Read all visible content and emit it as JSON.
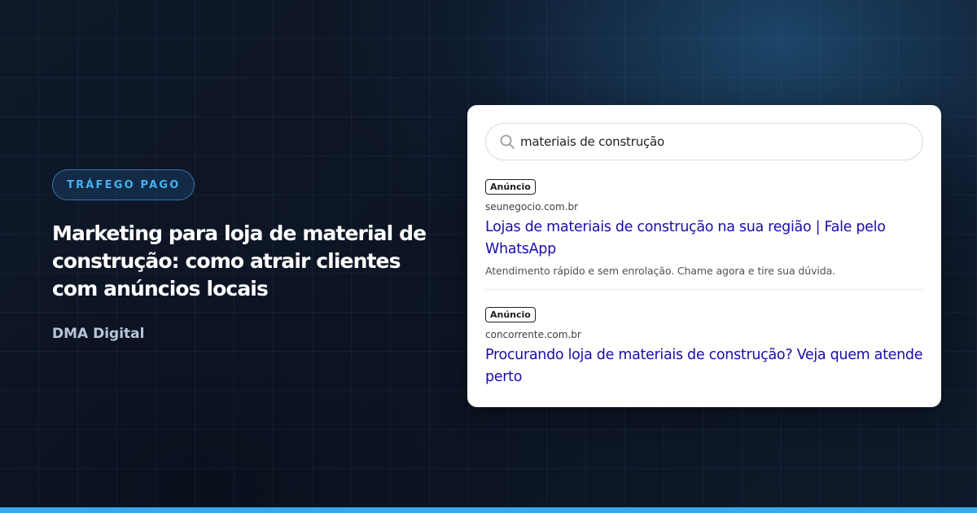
{
  "hero": {
    "category": "TRÁFEGO PAGO",
    "title": "Marketing para loja de material de construção: como atrair clientes com anúncios locais",
    "author": "DMA Digital"
  },
  "search": {
    "query": "materiais de construção",
    "icon": "search-icon"
  },
  "results": [
    {
      "badge": "Anúncio",
      "domain": "seunegocio.com.br",
      "title": "Lojas de materiais de construção na sua região | Fale pelo WhatsApp",
      "description": "Atendimento rápido e sem enrolação. Chame agora e tire sua dúvida."
    },
    {
      "badge": "Anúncio",
      "domain": "concorrente.com.br",
      "title": "Procurando loja de materiais de construção? Veja quem atende perto"
    }
  ],
  "colors": {
    "accent": "#47b1f2",
    "bottom_bar": "#3aa8e8",
    "link": "#1a0dab",
    "background": "#0d1524"
  }
}
